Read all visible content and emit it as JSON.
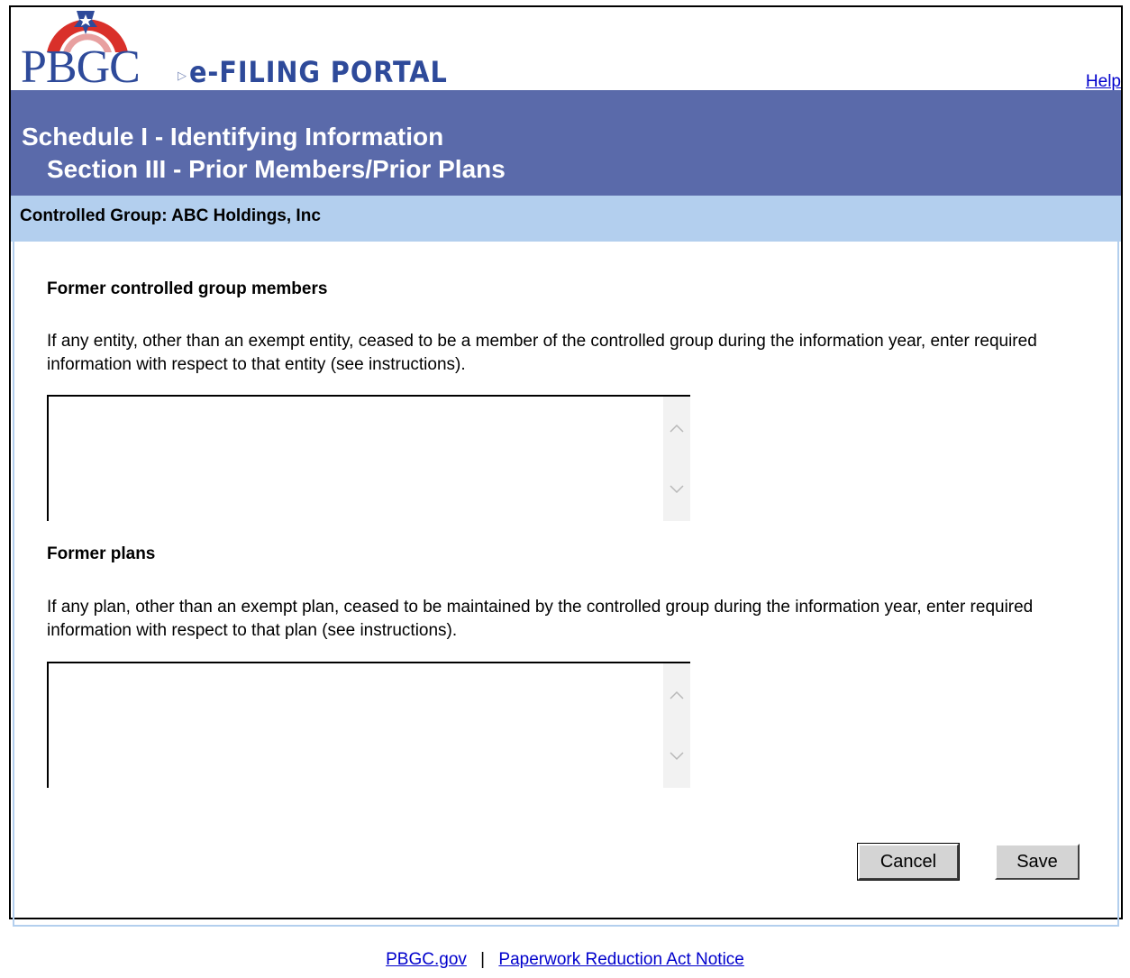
{
  "header": {
    "logo_text": "PBGC",
    "logo_subtitle": "e-FILING PORTAL",
    "help_label": "Help"
  },
  "title": {
    "line1": "Schedule I - Identifying Information",
    "line2": "Section III - Prior Members/Prior Plans"
  },
  "group_bar": {
    "label": "Controlled Group: ABC Holdings, Inc"
  },
  "sections": [
    {
      "heading": "Former controlled group members",
      "description": "If any entity, other than an exempt entity, ceased to be a member of the controlled group during the information year, enter required information with respect to that entity (see instructions).",
      "value": ""
    },
    {
      "heading": "Former plans",
      "description": "If any plan, other than an exempt plan, ceased to be maintained by the controlled group during the information year, enter required information with respect to that plan (see instructions).",
      "value": ""
    }
  ],
  "buttons": {
    "cancel": "Cancel",
    "save": "Save"
  },
  "footer": {
    "link1": "PBGC.gov",
    "separator": "|",
    "link2": "Paperwork Reduction Act Notice"
  },
  "colors": {
    "title_bar": "#5a6aaa",
    "group_bar": "#b3cfee",
    "logo_blue": "#2e4a9a",
    "logo_red": "#d9302a"
  }
}
